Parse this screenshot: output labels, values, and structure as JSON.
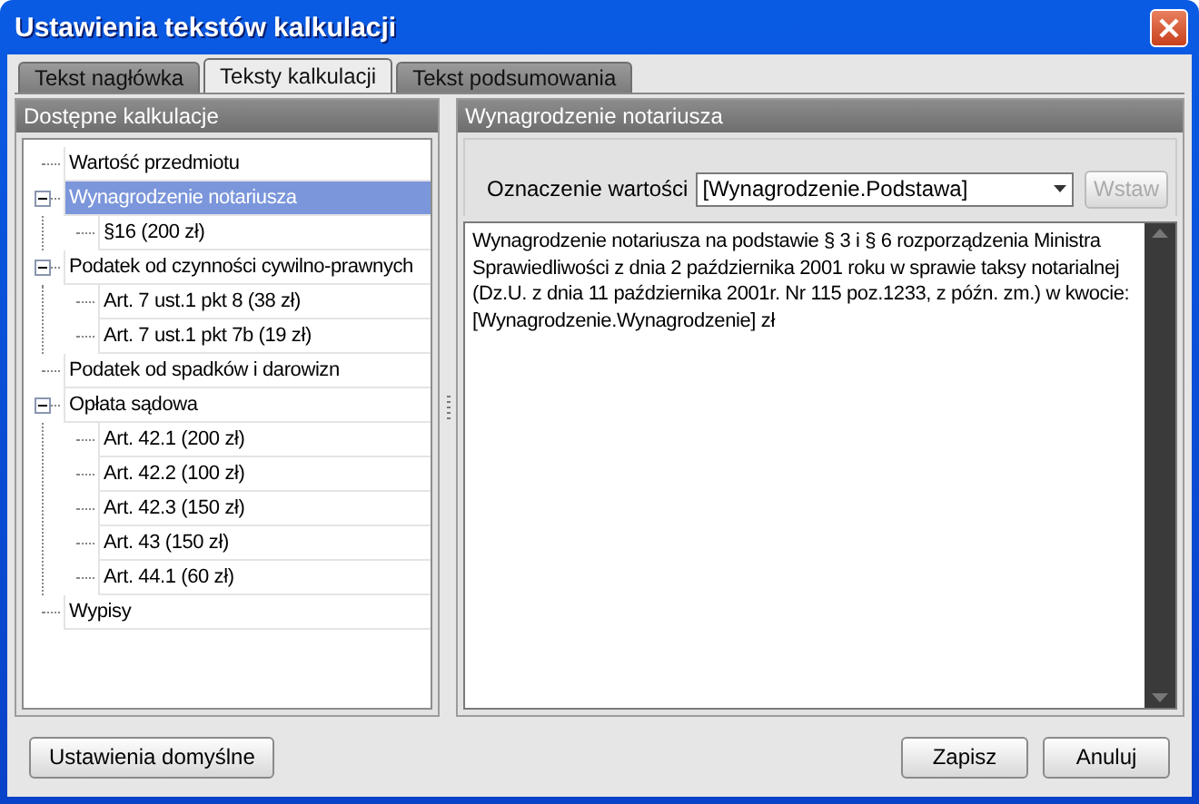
{
  "window": {
    "title": "Ustawienia tekstów kalkulacji"
  },
  "tabs": [
    {
      "label": "Tekst nagłówka",
      "selected": false
    },
    {
      "label": "Teksty kalkulacji",
      "selected": true
    },
    {
      "label": "Tekst podsumowania",
      "selected": false
    }
  ],
  "left_panel": {
    "title": "Dostępne kalkulacje",
    "tree": [
      {
        "label": "Wartość przedmiotu",
        "selected": false
      },
      {
        "label": "Wynagrodzenie notariusza",
        "selected": true,
        "expanded": true,
        "children": [
          {
            "label": "§16 (200 zł)",
            "selected": false
          }
        ]
      },
      {
        "label": "Podatek od czynności cywilno-prawnych",
        "selected": false,
        "expanded": true,
        "children": [
          {
            "label": "Art. 7 ust.1 pkt 8 (38 zł)",
            "selected": false
          },
          {
            "label": "Art. 7 ust.1 pkt 7b (19 zł)",
            "selected": false
          }
        ]
      },
      {
        "label": "Podatek od spadków i darowizn",
        "selected": false
      },
      {
        "label": "Opłata sądowa",
        "selected": false,
        "expanded": true,
        "children": [
          {
            "label": "Art. 42.1 (200 zł)",
            "selected": false
          },
          {
            "label": "Art. 42.2 (100 zł)",
            "selected": false
          },
          {
            "label": "Art. 42.3 (150 zł)",
            "selected": false
          },
          {
            "label": "Art. 43 (150 zł)",
            "selected": false
          },
          {
            "label": "Art. 44.1 (60 zł)",
            "selected": false
          }
        ]
      },
      {
        "label": "Wypisy",
        "selected": false
      }
    ]
  },
  "right_panel": {
    "title": "Wynagrodzenie notariusza",
    "field_label": "Oznaczenie wartości",
    "combo_value": "[Wynagrodzenie.Podstawa]",
    "insert_button": {
      "label": "Wstaw",
      "disabled": true
    },
    "text": "Wynagrodzenie notariusza na podstawie § 3 i § 6 rozporządzenia Ministra\nSprawiedliwości z dnia 2 października 2001 roku w sprawie taksy notarialnej\n(Dz.U. z dnia 11 października 2001r. Nr 115 poz.1233, z późn. zm.) w kwocie:\n[Wynagrodzenie.Wynagrodzenie] zł"
  },
  "buttons": {
    "left": [
      "Ustawienia domyślne"
    ],
    "right": [
      "Zapisz",
      "Anuluj"
    ]
  }
}
